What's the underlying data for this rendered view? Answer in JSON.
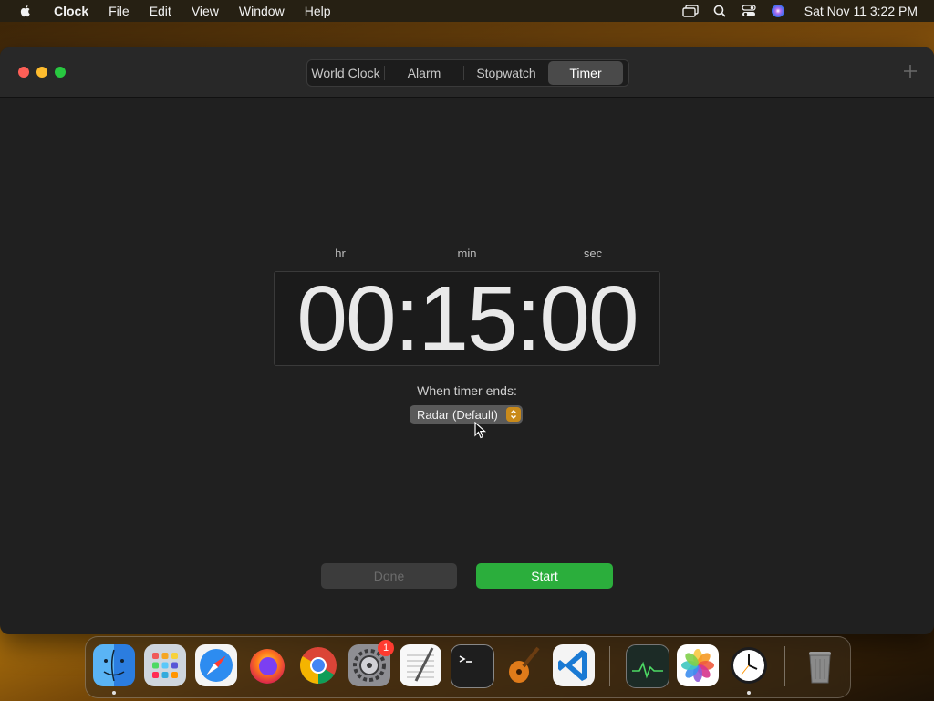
{
  "menubar": {
    "app_name": "Clock",
    "items": [
      "File",
      "Edit",
      "View",
      "Window",
      "Help"
    ],
    "datetime": "Sat Nov 11  3:22 PM"
  },
  "tabs": [
    {
      "label": "World Clock",
      "active": false
    },
    {
      "label": "Alarm",
      "active": false
    },
    {
      "label": "Stopwatch",
      "active": false
    },
    {
      "label": "Timer",
      "active": true
    }
  ],
  "timer": {
    "labels": {
      "hr": "hr",
      "min": "min",
      "sec": "sec"
    },
    "display": "00:15:00",
    "ends_label": "When timer ends:",
    "sound": "Radar (Default)"
  },
  "buttons": {
    "done": "Done",
    "start": "Start"
  },
  "dock": {
    "apps": [
      "finder",
      "launchpad",
      "safari",
      "firefox",
      "chrome",
      "system-settings",
      "textedit",
      "terminal",
      "garageband",
      "vscode",
      "activity-monitor",
      "photos",
      "clock",
      "trash"
    ],
    "settings_badge": "1"
  },
  "colors": {
    "accent_green": "#2bae3c",
    "window_bg": "#202020",
    "stepper": "#c98a1a"
  }
}
